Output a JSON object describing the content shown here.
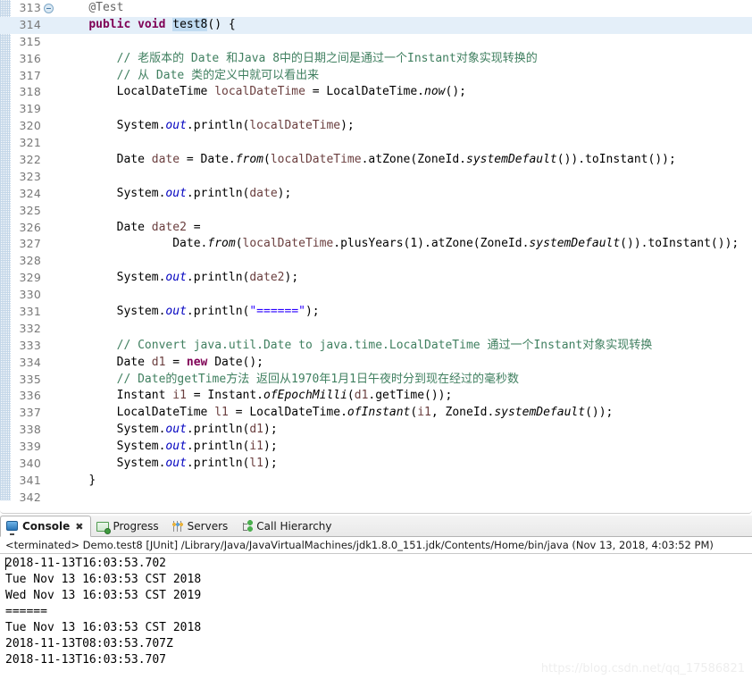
{
  "editor": {
    "first_line": 313,
    "highlighted_line": 314,
    "selected_token": "test8",
    "lines": [
      {
        "no": "313",
        "fold": true,
        "hl": false,
        "indent": 4,
        "tokens": [
          {
            "t": "annot",
            "v": "@Test"
          }
        ]
      },
      {
        "no": "314",
        "fold": false,
        "hl": true,
        "indent": 4,
        "tokens": [
          {
            "t": "kw",
            "v": "public"
          },
          {
            "t": "plain",
            "v": " "
          },
          {
            "t": "kw",
            "v": "void"
          },
          {
            "t": "plain",
            "v": " "
          },
          {
            "t": "sel",
            "v": "test8"
          },
          {
            "t": "plain",
            "v": "() {"
          }
        ]
      },
      {
        "no": "315",
        "fold": false,
        "hl": false,
        "indent": 0,
        "tokens": []
      },
      {
        "no": "316",
        "fold": false,
        "hl": false,
        "indent": 8,
        "tokens": [
          {
            "t": "cmt",
            "v": "// 老版本的 Date 和Java 8中的日期之间是通过一个Instant对象实现转换的"
          }
        ]
      },
      {
        "no": "317",
        "fold": false,
        "hl": false,
        "indent": 8,
        "tokens": [
          {
            "t": "cmt",
            "v": "// 从 Date 类的定义中就可以看出来"
          }
        ]
      },
      {
        "no": "318",
        "fold": false,
        "hl": false,
        "indent": 8,
        "tokens": [
          {
            "t": "plain",
            "v": "LocalDateTime "
          },
          {
            "t": "localvar",
            "v": "localDateTime"
          },
          {
            "t": "plain",
            "v": " = LocalDateTime."
          },
          {
            "t": "statmeth",
            "v": "now"
          },
          {
            "t": "plain",
            "v": "();"
          }
        ]
      },
      {
        "no": "319",
        "fold": false,
        "hl": false,
        "indent": 0,
        "tokens": []
      },
      {
        "no": "320",
        "fold": false,
        "hl": false,
        "indent": 8,
        "tokens": [
          {
            "t": "plain",
            "v": "System."
          },
          {
            "t": "fieldstat",
            "v": "out"
          },
          {
            "t": "plain",
            "v": ".println("
          },
          {
            "t": "localvar",
            "v": "localDateTime"
          },
          {
            "t": "plain",
            "v": ");"
          }
        ]
      },
      {
        "no": "321",
        "fold": false,
        "hl": false,
        "indent": 0,
        "tokens": []
      },
      {
        "no": "322",
        "fold": false,
        "hl": false,
        "indent": 8,
        "tokens": [
          {
            "t": "plain",
            "v": "Date "
          },
          {
            "t": "localvar",
            "v": "date"
          },
          {
            "t": "plain",
            "v": " = Date."
          },
          {
            "t": "statmeth",
            "v": "from"
          },
          {
            "t": "plain",
            "v": "("
          },
          {
            "t": "localvar",
            "v": "localDateTime"
          },
          {
            "t": "plain",
            "v": ".atZone(ZoneId."
          },
          {
            "t": "statmeth",
            "v": "systemDefault"
          },
          {
            "t": "plain",
            "v": "()).toInstant());"
          }
        ]
      },
      {
        "no": "323",
        "fold": false,
        "hl": false,
        "indent": 0,
        "tokens": []
      },
      {
        "no": "324",
        "fold": false,
        "hl": false,
        "indent": 8,
        "tokens": [
          {
            "t": "plain",
            "v": "System."
          },
          {
            "t": "fieldstat",
            "v": "out"
          },
          {
            "t": "plain",
            "v": ".println("
          },
          {
            "t": "localvar",
            "v": "date"
          },
          {
            "t": "plain",
            "v": ");"
          }
        ]
      },
      {
        "no": "325",
        "fold": false,
        "hl": false,
        "indent": 0,
        "tokens": []
      },
      {
        "no": "326",
        "fold": false,
        "hl": false,
        "indent": 8,
        "tokens": [
          {
            "t": "plain",
            "v": "Date "
          },
          {
            "t": "localvar",
            "v": "date2"
          },
          {
            "t": "plain",
            "v": " ="
          }
        ]
      },
      {
        "no": "327",
        "fold": false,
        "hl": false,
        "indent": 16,
        "tokens": [
          {
            "t": "plain",
            "v": "Date."
          },
          {
            "t": "statmeth",
            "v": "from"
          },
          {
            "t": "plain",
            "v": "("
          },
          {
            "t": "localvar",
            "v": "localDateTime"
          },
          {
            "t": "plain",
            "v": ".plusYears(1).atZone(ZoneId."
          },
          {
            "t": "statmeth",
            "v": "systemDefault"
          },
          {
            "t": "plain",
            "v": "()).toInstant());"
          }
        ]
      },
      {
        "no": "328",
        "fold": false,
        "hl": false,
        "indent": 0,
        "tokens": []
      },
      {
        "no": "329",
        "fold": false,
        "hl": false,
        "indent": 8,
        "tokens": [
          {
            "t": "plain",
            "v": "System."
          },
          {
            "t": "fieldstat",
            "v": "out"
          },
          {
            "t": "plain",
            "v": ".println("
          },
          {
            "t": "localvar",
            "v": "date2"
          },
          {
            "t": "plain",
            "v": ");"
          }
        ]
      },
      {
        "no": "330",
        "fold": false,
        "hl": false,
        "indent": 0,
        "tokens": []
      },
      {
        "no": "331",
        "fold": false,
        "hl": false,
        "indent": 8,
        "tokens": [
          {
            "t": "plain",
            "v": "System."
          },
          {
            "t": "fieldstat",
            "v": "out"
          },
          {
            "t": "plain",
            "v": ".println("
          },
          {
            "t": "str",
            "v": "\"======\""
          },
          {
            "t": "plain",
            "v": ");"
          }
        ]
      },
      {
        "no": "332",
        "fold": false,
        "hl": false,
        "indent": 0,
        "tokens": []
      },
      {
        "no": "333",
        "fold": false,
        "hl": false,
        "indent": 8,
        "tokens": [
          {
            "t": "cmt",
            "v": "// Convert java.util.Date to java.time.LocalDateTime 通过一个Instant对象实现转换"
          }
        ]
      },
      {
        "no": "334",
        "fold": false,
        "hl": false,
        "indent": 8,
        "tokens": [
          {
            "t": "plain",
            "v": "Date "
          },
          {
            "t": "localvar",
            "v": "d1"
          },
          {
            "t": "plain",
            "v": " = "
          },
          {
            "t": "kw",
            "v": "new"
          },
          {
            "t": "plain",
            "v": " Date();"
          }
        ]
      },
      {
        "no": "335",
        "fold": false,
        "hl": false,
        "indent": 8,
        "tokens": [
          {
            "t": "cmt",
            "v": "// Date的getTime方法 返回从1970年1月1日午夜时分到现在经过的毫秒数"
          }
        ]
      },
      {
        "no": "336",
        "fold": false,
        "hl": false,
        "indent": 8,
        "tokens": [
          {
            "t": "plain",
            "v": "Instant "
          },
          {
            "t": "localvar",
            "v": "i1"
          },
          {
            "t": "plain",
            "v": " = Instant."
          },
          {
            "t": "statmeth",
            "v": "ofEpochMilli"
          },
          {
            "t": "plain",
            "v": "("
          },
          {
            "t": "localvar",
            "v": "d1"
          },
          {
            "t": "plain",
            "v": ".getTime());"
          }
        ]
      },
      {
        "no": "337",
        "fold": false,
        "hl": false,
        "indent": 8,
        "tokens": [
          {
            "t": "plain",
            "v": "LocalDateTime "
          },
          {
            "t": "localvar",
            "v": "l1"
          },
          {
            "t": "plain",
            "v": " = LocalDateTime."
          },
          {
            "t": "statmeth",
            "v": "ofInstant"
          },
          {
            "t": "plain",
            "v": "("
          },
          {
            "t": "localvar",
            "v": "i1"
          },
          {
            "t": "plain",
            "v": ", ZoneId."
          },
          {
            "t": "statmeth",
            "v": "systemDefault"
          },
          {
            "t": "plain",
            "v": "());"
          }
        ]
      },
      {
        "no": "338",
        "fold": false,
        "hl": false,
        "indent": 8,
        "tokens": [
          {
            "t": "plain",
            "v": "System."
          },
          {
            "t": "fieldstat",
            "v": "out"
          },
          {
            "t": "plain",
            "v": ".println("
          },
          {
            "t": "localvar",
            "v": "d1"
          },
          {
            "t": "plain",
            "v": ");"
          }
        ]
      },
      {
        "no": "339",
        "fold": false,
        "hl": false,
        "indent": 8,
        "tokens": [
          {
            "t": "plain",
            "v": "System."
          },
          {
            "t": "fieldstat",
            "v": "out"
          },
          {
            "t": "plain",
            "v": ".println("
          },
          {
            "t": "localvar",
            "v": "i1"
          },
          {
            "t": "plain",
            "v": ");"
          }
        ]
      },
      {
        "no": "340",
        "fold": false,
        "hl": false,
        "indent": 8,
        "tokens": [
          {
            "t": "plain",
            "v": "System."
          },
          {
            "t": "fieldstat",
            "v": "out"
          },
          {
            "t": "plain",
            "v": ".println("
          },
          {
            "t": "localvar",
            "v": "l1"
          },
          {
            "t": "plain",
            "v": ");"
          }
        ]
      },
      {
        "no": "341",
        "fold": false,
        "hl": false,
        "indent": 4,
        "tokens": [
          {
            "t": "plain",
            "v": "}"
          }
        ]
      },
      {
        "no": "342",
        "fold": false,
        "hl": false,
        "indent": 0,
        "tokens": []
      }
    ]
  },
  "console": {
    "tabs": [
      {
        "label": "Console",
        "icon": "console-icon",
        "active": true,
        "closable": true
      },
      {
        "label": "Progress",
        "icon": "progress-icon",
        "active": false,
        "closable": false
      },
      {
        "label": "Servers",
        "icon": "servers-icon",
        "active": false,
        "closable": false
      },
      {
        "label": "Call Hierarchy",
        "icon": "call-hierarchy-icon",
        "active": false,
        "closable": false
      }
    ],
    "close_glyph": "✖",
    "launch_line": "<terminated> Demo.test8 [JUnit] /Library/Java/JavaVirtualMachines/jdk1.8.0_151.jdk/Contents/Home/bin/java (Nov 13, 2018, 4:03:52 PM)",
    "output_lines": [
      "2018-11-13T16:03:53.702",
      "Tue Nov 13 16:03:53 CST 2018",
      "Wed Nov 13 16:03:53 CST 2019",
      "======",
      "Tue Nov 13 16:03:53 CST 2018",
      "2018-11-13T08:03:53.707Z",
      "2018-11-13T16:03:53.707"
    ]
  },
  "watermark": {
    "text": "https://blog.csdn.net/qq_17586821"
  },
  "colors": {
    "keyword": "#7F0055",
    "comment": "#3F7F5F",
    "string": "#2A00FF",
    "local_variable": "#6A3E3E",
    "static_field": "#0000C0",
    "line_highlight": "#E4EFF9",
    "selection": "#C0DBF1",
    "line_number": "#787878"
  }
}
